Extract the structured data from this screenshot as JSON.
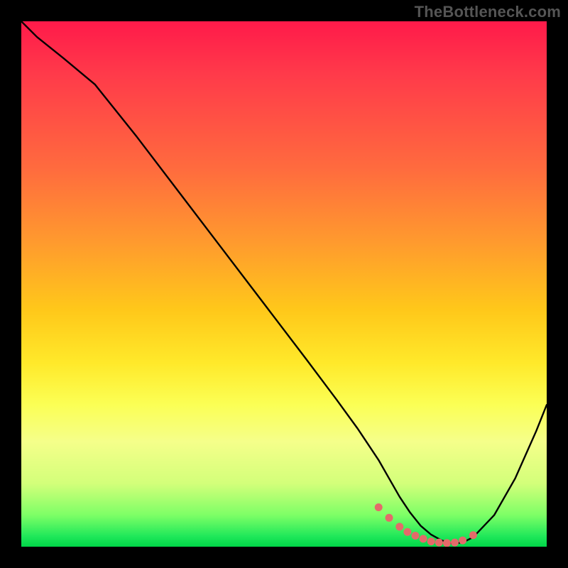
{
  "watermark": "TheBottleneck.com",
  "chart_data": {
    "type": "line",
    "title": "",
    "xlabel": "",
    "ylabel": "",
    "xlim": [
      0,
      100
    ],
    "ylim": [
      0,
      100
    ],
    "series": [
      {
        "name": "bottleneck-curve",
        "x": [
          0,
          3,
          8,
          14,
          22,
          30,
          38,
          46,
          54,
          60,
          64,
          68,
          70,
          72,
          74,
          76,
          78,
          80,
          82,
          84,
          86,
          90,
          94,
          98,
          100
        ],
        "values": [
          100,
          97,
          93,
          88,
          78,
          67.5,
          57,
          46.5,
          36,
          28,
          22.5,
          16.5,
          13,
          9.5,
          6.5,
          4,
          2.3,
          1.2,
          0.6,
          0.8,
          1.8,
          6,
          13,
          22,
          27
        ]
      }
    ],
    "markers": {
      "name": "highlight-points",
      "color": "#e46a6a",
      "x": [
        68,
        70,
        72,
        73.5,
        75,
        76.5,
        78,
        79.5,
        81,
        82.5,
        84,
        86
      ],
      "values": [
        7.5,
        5.5,
        3.8,
        2.8,
        2.1,
        1.5,
        1.0,
        0.8,
        0.7,
        0.8,
        1.2,
        2.2
      ]
    },
    "gradient_stops": [
      {
        "pos": 0,
        "color": "#ff1a4a"
      },
      {
        "pos": 10,
        "color": "#ff3a4a"
      },
      {
        "pos": 28,
        "color": "#ff6b3e"
      },
      {
        "pos": 42,
        "color": "#ff9a2e"
      },
      {
        "pos": 55,
        "color": "#ffc81a"
      },
      {
        "pos": 65,
        "color": "#ffe92a"
      },
      {
        "pos": 73,
        "color": "#fbff55"
      },
      {
        "pos": 80,
        "color": "#f5ff8a"
      },
      {
        "pos": 88,
        "color": "#d3ff7a"
      },
      {
        "pos": 94,
        "color": "#7dff66"
      },
      {
        "pos": 98,
        "color": "#20e85a"
      },
      {
        "pos": 100,
        "color": "#00d648"
      }
    ]
  }
}
